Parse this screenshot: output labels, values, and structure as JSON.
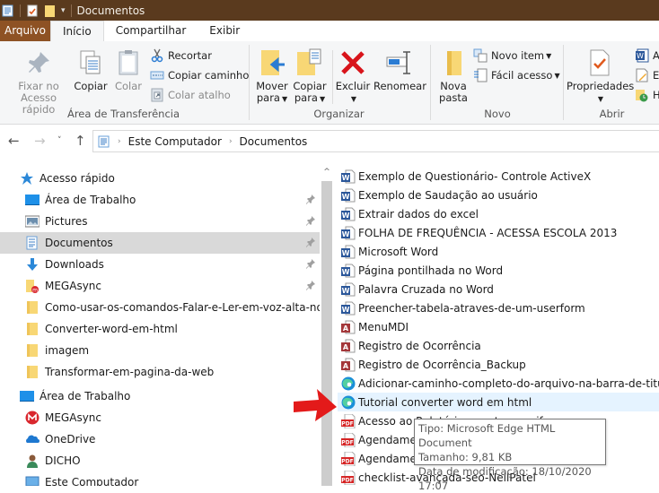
{
  "window": {
    "title": "Documentos"
  },
  "tabs": [
    {
      "label": "Arquivo"
    },
    {
      "label": "Início"
    },
    {
      "label": "Compartilhar"
    },
    {
      "label": "Exibir"
    }
  ],
  "ribbon": {
    "clipboard": {
      "group_label": "Área de Transferência",
      "pin_line1": "Fixar no",
      "pin_line2": "Acesso rápido",
      "copy": "Copiar",
      "paste": "Colar",
      "cut": "Recortar",
      "copy_path": "Copiar caminho",
      "paste_shortcut": "Colar atalho"
    },
    "organize": {
      "group_label": "Organizar",
      "move_line1": "Mover",
      "move_line2": "para",
      "copy_line1": "Copiar",
      "copy_line2": "para",
      "delete": "Excluir",
      "rename": "Renomear"
    },
    "new": {
      "group_label": "Novo",
      "new_folder_line1": "Nova",
      "new_folder_line2": "pasta",
      "new_item": "Novo item",
      "easy_access": "Fácil acesso"
    },
    "open": {
      "group_label": "Abrir",
      "properties": "Propriedades",
      "open_partial": "A",
      "edit_partial": "E",
      "history_partial": "H"
    }
  },
  "address": {
    "crumbs": [
      "Este Computador",
      "Documentos"
    ]
  },
  "nav": {
    "items": [
      {
        "label": "Acesso rápido",
        "icon": "star-icon",
        "level": 0,
        "pinned": false
      },
      {
        "label": "Área de Trabalho",
        "icon": "desktop-icon",
        "level": 1,
        "pinned": true
      },
      {
        "label": "Pictures",
        "icon": "pictures-icon",
        "level": 1,
        "pinned": true
      },
      {
        "label": "Documentos",
        "icon": "documents-icon",
        "level": 1,
        "pinned": true,
        "selected": true
      },
      {
        "label": "Downloads",
        "icon": "download-icon",
        "level": 1,
        "pinned": true
      },
      {
        "label": "MEGAsync",
        "icon": "mega-folder-icon",
        "level": 1,
        "pinned": true
      },
      {
        "label": "Como-usar-os-comandos-Falar-e-Ler-em-voz-alta-no-Word",
        "icon": "folder-icon",
        "level": 1,
        "pinned": false
      },
      {
        "label": "Converter-word-em-html",
        "icon": "folder-icon",
        "level": 1,
        "pinned": false
      },
      {
        "label": "imagem",
        "icon": "folder-icon",
        "level": 1,
        "pinned": false
      },
      {
        "label": "Transformar-em-pagina-da-web",
        "icon": "folder-icon",
        "level": 1,
        "pinned": false
      },
      {
        "label": "Área de Trabalho",
        "icon": "desktop-icon",
        "level": 0,
        "pinned": false
      },
      {
        "label": "MEGAsync",
        "icon": "mega-icon",
        "level": 1,
        "pinned": false
      },
      {
        "label": "OneDrive",
        "icon": "onedrive-icon",
        "level": 1,
        "pinned": false
      },
      {
        "label": "DICHO",
        "icon": "user-icon",
        "level": 1,
        "pinned": false
      },
      {
        "label": "Este Computador",
        "icon": "computer-icon",
        "level": 1,
        "pinned": false
      }
    ]
  },
  "files": [
    {
      "name": "Exemplo de Questionário- Controle ActiveX",
      "type": "word"
    },
    {
      "name": "Exemplo de Saudação ao usuário",
      "type": "word"
    },
    {
      "name": "Extrair dados do excel",
      "type": "word"
    },
    {
      "name": "FOLHA DE FREQUÊNCIA - ACESSA ESCOLA 2013",
      "type": "word"
    },
    {
      "name": "Microsoft Word",
      "type": "word"
    },
    {
      "name": "Página pontilhada no Word",
      "type": "word"
    },
    {
      "name": "Palavra Cruzada no Word",
      "type": "word"
    },
    {
      "name": "Preencher-tabela-atraves-de-um-userform",
      "type": "word"
    },
    {
      "name": "MenuMDI",
      "type": "access"
    },
    {
      "name": "Registro de Ocorrência",
      "type": "access"
    },
    {
      "name": "Registro de Ocorrência_Backup",
      "type": "access"
    },
    {
      "name": "Adicionar-caminho-completo-do-arquivo-na-barra-de-titulo",
      "type": "edge"
    },
    {
      "name": "Tutorial converter word em html",
      "type": "edge",
      "hover": true
    },
    {
      "name": "Acesso ao Relatório ... ento e verif",
      "type": "pdf"
    },
    {
      "name": "Agendamer",
      "type": "pdf"
    },
    {
      "name": "Agendamer",
      "type": "pdf"
    },
    {
      "name": "checklist-avançada-seo-NeilPatel",
      "type": "pdf"
    }
  ],
  "tooltip": {
    "type": "Tipo: Microsoft Edge HTML Document",
    "size": "Tamanho: 9,81 KB",
    "modified": "Data de modificação: 18/10/2020 17:07"
  },
  "colors": {
    "titlebar": "#5a3a1e",
    "file_tab": "#8e5224",
    "selection": "#d9d9d9",
    "hover": "#e5f3ff",
    "annotation_arrow": "#e31a1a"
  }
}
